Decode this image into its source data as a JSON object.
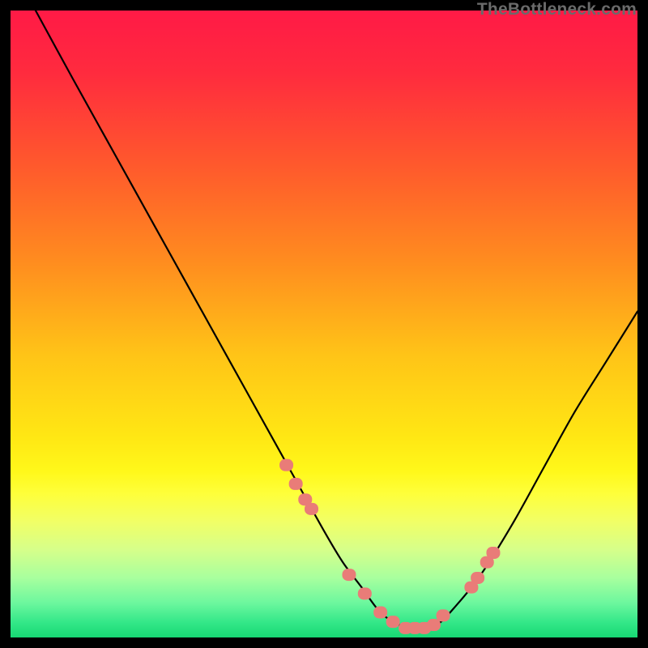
{
  "watermark": "TheBottleneck.com",
  "chart_data": {
    "type": "line",
    "title": "",
    "xlabel": "",
    "ylabel": "",
    "xlim": [
      0,
      100
    ],
    "ylim": [
      0,
      100
    ],
    "series": [
      {
        "name": "bottleneck-curve",
        "x": [
          4,
          10,
          15,
          20,
          25,
          30,
          35,
          40,
          45,
          50,
          53,
          56,
          59,
          62,
          65,
          68,
          71,
          75,
          80,
          85,
          90,
          95,
          100
        ],
        "y": [
          100,
          89,
          80,
          71,
          62,
          53,
          44,
          35,
          26,
          17,
          12,
          8,
          4,
          2,
          1,
          2,
          5,
          10,
          18,
          27,
          36,
          44,
          52
        ]
      }
    ],
    "markers": {
      "name": "laptop-data-points",
      "x": [
        44,
        45.5,
        47,
        48,
        54,
        56.5,
        59,
        61,
        63,
        64.5,
        66,
        67.5,
        69,
        73.5,
        74.5,
        76,
        77
      ],
      "y": [
        27.5,
        24.5,
        22,
        20.5,
        10,
        7,
        4,
        2.5,
        1.5,
        1.5,
        1.5,
        2,
        3.5,
        8,
        9.5,
        12,
        13.5
      ]
    },
    "gradient_stops": [
      {
        "offset": 0.0,
        "color": "#ff1a46"
      },
      {
        "offset": 0.1,
        "color": "#ff2b3e"
      },
      {
        "offset": 0.25,
        "color": "#ff5a2c"
      },
      {
        "offset": 0.4,
        "color": "#ff8c1f"
      },
      {
        "offset": 0.55,
        "color": "#ffc417"
      },
      {
        "offset": 0.68,
        "color": "#ffe714"
      },
      {
        "offset": 0.735,
        "color": "#fff81a"
      },
      {
        "offset": 0.77,
        "color": "#feff3a"
      },
      {
        "offset": 0.815,
        "color": "#f1ff66"
      },
      {
        "offset": 0.86,
        "color": "#d6ff8a"
      },
      {
        "offset": 0.905,
        "color": "#a8ff9e"
      },
      {
        "offset": 0.945,
        "color": "#6cf79e"
      },
      {
        "offset": 0.975,
        "color": "#35e889"
      },
      {
        "offset": 1.0,
        "color": "#17d873"
      }
    ]
  }
}
